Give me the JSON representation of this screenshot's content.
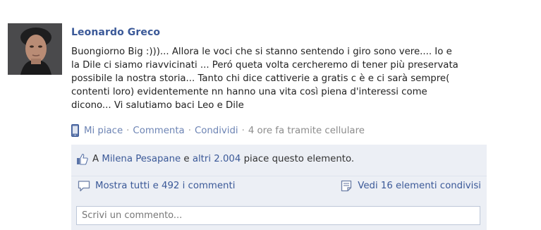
{
  "post": {
    "author": "Leonardo Greco",
    "message_lines": [
      "Buongiorno Big :)))... Allora le voci che si stanno sentendo i giro sono vere.... Io e",
      "la Dile ci siamo riavvicinati ... Peró queta volta cercheremo di tener più preservata",
      "possibile la nostra storia... Tanto chi dice cattiverie a gratis c è e ci sarà sempre(",
      "contenti loro) evidentemente nn hanno una vita così piena d'interessi come",
      "dicono... Vi salutiamo baci Leo e Dile"
    ]
  },
  "actions": {
    "like": "Mi piace",
    "comment": "Commenta",
    "share": "Condividi",
    "separator": "·",
    "timestamp": "4 ore fa tramite cellulare"
  },
  "likes": {
    "prefix": "A",
    "first_liker": "Milena Pesapane",
    "connector": "e",
    "others_link": "altri 2.004",
    "suffix": "piace questo elemento."
  },
  "comments": {
    "show_all": "Mostra tutti e 492 i commenti",
    "shares": "Vedi 16 elementi condivisi"
  },
  "comment_input": {
    "placeholder": "Scrivi un commento..."
  },
  "colors": {
    "link": "#3b5998",
    "panel_bg": "#eceff5"
  },
  "icons": {
    "meta": "mobile-phone-icon",
    "likes": "thumbs-up-icon",
    "comments": "speech-bubble-icon",
    "shares": "shared-items-icon"
  }
}
